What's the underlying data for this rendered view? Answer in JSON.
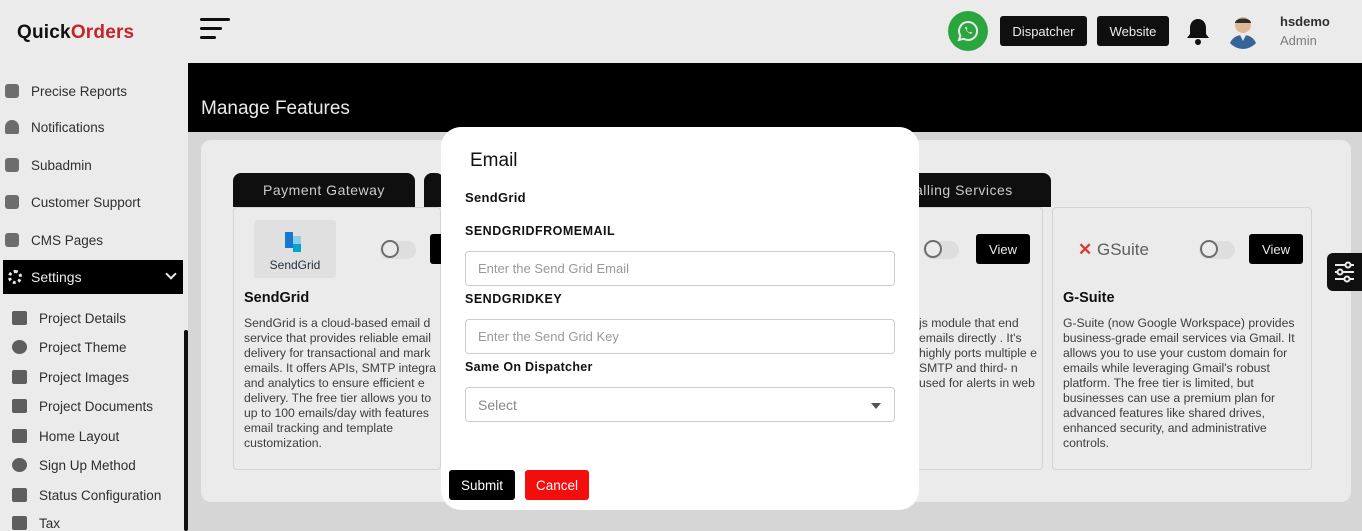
{
  "brand": {
    "logo_text_a": "Quick",
    "logo_text_b": "Orders"
  },
  "header": {
    "dispatcher_label": "Dispatcher",
    "website_label": "Website",
    "user_name": "hsdemo",
    "user_role": "Admin"
  },
  "sidebar": {
    "items": [
      {
        "label": "Precise Reports"
      },
      {
        "label": "Notifications"
      },
      {
        "label": "Subadmin"
      },
      {
        "label": "Customer Support"
      },
      {
        "label": "CMS Pages"
      }
    ],
    "settings_label": "Settings",
    "sub_items": [
      {
        "label": "Project Details"
      },
      {
        "label": "Project Theme"
      },
      {
        "label": "Project Images"
      },
      {
        "label": "Project Documents"
      },
      {
        "label": "Home Layout"
      },
      {
        "label": "Sign Up Method"
      },
      {
        "label": "Status Configuration"
      },
      {
        "label": "Tax"
      }
    ]
  },
  "page": {
    "title": "Manage Features"
  },
  "tabs": [
    {
      "label": "Payment Gateway"
    },
    {
      "label": "alling Services"
    }
  ],
  "cards": [
    {
      "title": "SendGrid",
      "logo": "SendGrid",
      "description": "SendGrid is a cloud-based email d service that provides reliable email delivery for transactional and mark emails. It offers APIs, SMTP integra and analytics to ensure efficient e delivery. The free tier allows you to up to 100 emails/day with features email tracking and template customization."
    },
    {
      "title": "",
      "description": "js module that end emails directly . It's highly ports multiple e SMTP and third- n used for alerts in web",
      "view_label": "View"
    },
    {
      "title": "G-Suite",
      "logo": "GSuite",
      "description": "G-Suite (now Google Workspace) provides business-grade email services via Gmail. It allows you to use your custom domain for emails while leveraging Gmail's robust platform. The free tier is limited, but businesses can use a premium plan for advanced features like shared drives, enhanced security, and administrative controls.",
      "view_label": "View"
    }
  ],
  "modal": {
    "title": "Email",
    "provider": "SendGrid",
    "field1_label": "SENDGRIDFROMEMAIL",
    "field1_placeholder": "Enter the Send Grid Email",
    "field2_label": "SENDGRIDKEY",
    "field2_placeholder": "Enter the Send Grid Key",
    "field3_label": "Same On Dispatcher",
    "select_value": "Select",
    "submit_label": "Submit",
    "cancel_label": "Cancel"
  },
  "colors": {
    "accent": "#000000",
    "danger": "#f30d0d",
    "whatsapp": "#2fb545",
    "brand_red": "#d9262c"
  }
}
